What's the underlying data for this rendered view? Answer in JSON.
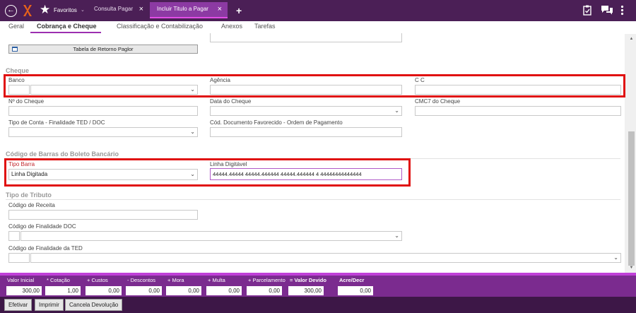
{
  "topbar": {
    "favorites_label": "Favoritos",
    "tabs": [
      {
        "label": "Consulta Pagar"
      },
      {
        "label": "Incluir Titulo a Pagar"
      }
    ],
    "close_glyph": "×",
    "add_glyph": "+",
    "icons": [
      "back-icon",
      "logo-icon",
      "star-icon",
      "plus-icon",
      "clipboard-icon",
      "chat-icon",
      "kebab-menu-icon"
    ]
  },
  "subtabs": [
    {
      "label": "Geral"
    },
    {
      "label": "Cobrança e Cheque"
    },
    {
      "label": "Classificação e Contabilização"
    },
    {
      "label": "Anexos"
    },
    {
      "label": "Tarefas"
    }
  ],
  "retorno_button": "Tabela de Retorno Paglor",
  "cheque": {
    "section_title": "Cheque",
    "banco_label": "Banco",
    "agencia_label": "Agência",
    "cc_label": "C C",
    "numero_label": "Nº do Cheque",
    "data_label": "Data do Cheque",
    "cmc7_label": "CMC7 do Cheque",
    "tipo_conta_label": "Tipo de Conta - Finalidade TED / DOC",
    "cod_doc_label": "Cód. Documento Favorecido - Ordem de Pagamento"
  },
  "boleto": {
    "section_title": "Código de Barras do Boleto Bancário",
    "tipo_barra_label": "Tipo Barra",
    "tipo_barra_value": "Linha Digitada",
    "linha_digitavel_label": "Linha Digitável",
    "linha_digitavel_value": "44444.44444 44444.444444 44444.444444 4 44444444444444"
  },
  "tributo": {
    "section_title": "Tipo de Tributo",
    "receita_label": "Código de Receita",
    "finalidade_doc_label": "Código de Finalidade DOC",
    "finalidade_ted_label": "Código de Finalidade da TED"
  },
  "totals": [
    {
      "label": "Valor Inicial",
      "value": "300,00"
    },
    {
      "label": "* Cotação",
      "value": "1,00"
    },
    {
      "label": "+ Custos",
      "value": "0,00"
    },
    {
      "label": "- Descontos",
      "value": "0,00"
    },
    {
      "label": "+ Mora",
      "value": "0,00"
    },
    {
      "label": "+ Multa",
      "value": "0,00"
    },
    {
      "label": "+ Parcelamento",
      "value": "0,00"
    },
    {
      "label": "= Valor Devido",
      "value": "300,00"
    },
    {
      "label": "Acre/Decr",
      "value": "0,00"
    }
  ],
  "footer": {
    "efetivar": "Efetivar",
    "imprimir": "Imprimir",
    "cancela": "Cancela Devolução"
  },
  "colors": {
    "header": "#4b1f56",
    "active_tab": "#8c3aa3",
    "accent": "#9c2fb0",
    "highlight": "#e01010"
  }
}
